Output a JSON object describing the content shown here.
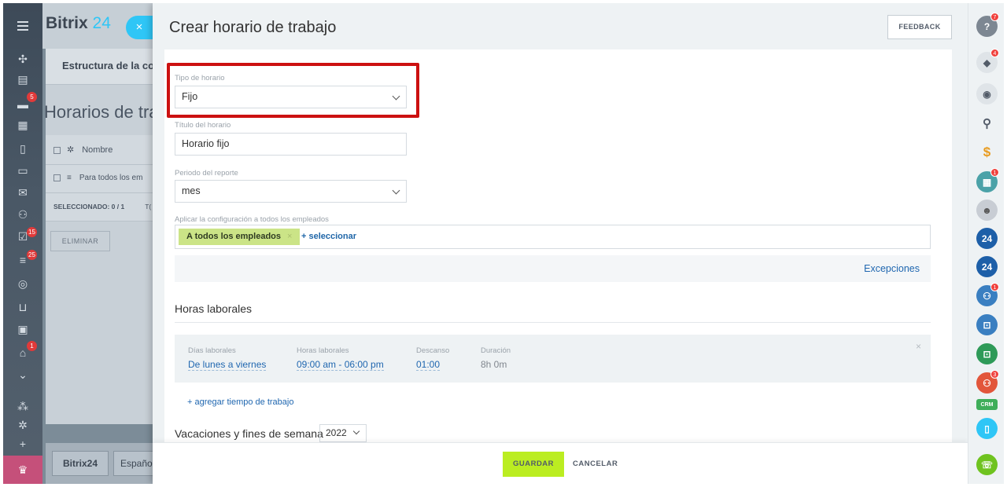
{
  "background": {
    "logo": "Bitrix",
    "logo_suffix": "24",
    "close_symbol": "×",
    "tab_label": "Estructura de la com",
    "page_title": "Horarios de tra",
    "grid_header": "Nombre",
    "grid_row": "Para todos los em",
    "selected_label": "SELECCIONADO: 0 / 1",
    "total_label": "T(",
    "delete_button": "ELIMINAR",
    "footer_logo": "Bitrix24",
    "footer_lang": "Español"
  },
  "left_rail": {
    "badges": {
      "chat": "5",
      "tasks": "15",
      "feed": "25",
      "store": "1"
    }
  },
  "panel": {
    "title": "Crear horario de trabajo",
    "feedback_label": "FEEDBACK"
  },
  "form": {
    "schedule_type": {
      "label": "Tipo de horario",
      "value": "Fijo"
    },
    "schedule_title": {
      "label": "Título del horario",
      "value": "Horario fijo"
    },
    "report_period": {
      "label": "Periodo del reporte",
      "value": "mes"
    },
    "apply_to": {
      "label": "Aplicar la configuración a todos los empleados",
      "tag": "A todos los empleados",
      "tag_remove": "×",
      "select_link": "+ seleccionar"
    },
    "exceptions_link": "Excepciones"
  },
  "work_hours": {
    "section_title": "Horas laborales",
    "card": {
      "days_label": "Días laborales",
      "days_value": "De lunes a viernes",
      "hours_label": "Horas laborales",
      "hours_value": "09:00 am - 06:00 pm",
      "break_label": "Descanso",
      "break_value": "01:00",
      "duration_label": "Duración",
      "duration_value": "8h 0m",
      "remove": "×"
    },
    "add_link": "+ agregar tiempo de trabajo"
  },
  "vacations": {
    "section_title": "Vacaciones y fines de semana",
    "year": "2022"
  },
  "footer": {
    "save_label": "GUARDAR",
    "cancel_label": "CANCELAR"
  },
  "right_rail": {
    "help_badge": "7",
    "notifications_badge": "4",
    "calendar_badge": "1",
    "group_badge": "1",
    "crm_group_badge": "3",
    "crm_label": "CRM",
    "portal_24_a": "24",
    "portal_24_b": "24"
  },
  "colors": {
    "accent": "#2fc6f6",
    "save_button": "#bbed21",
    "highlight": "#cc1010",
    "link": "#2067b0",
    "tag": "#cbe487"
  }
}
